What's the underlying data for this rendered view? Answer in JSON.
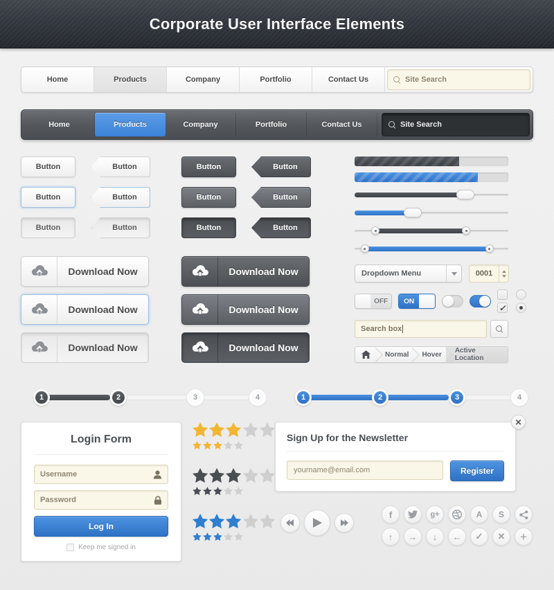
{
  "header": {
    "title": "Corporate User Interface Elements"
  },
  "nav_light": {
    "items": [
      {
        "label": "Home",
        "state": "normal"
      },
      {
        "label": "Products",
        "state": "active"
      },
      {
        "label": "Company",
        "state": "normal"
      },
      {
        "label": "Portfolio",
        "state": "normal"
      },
      {
        "label": "Contact Us",
        "state": "normal"
      }
    ],
    "search_placeholder": "Site Search"
  },
  "nav_dark": {
    "items": [
      {
        "label": "Home",
        "state": "normal"
      },
      {
        "label": "Products",
        "state": "active"
      },
      {
        "label": "Company",
        "state": "normal"
      },
      {
        "label": "Portfolio",
        "state": "normal"
      },
      {
        "label": "Contact Us",
        "state": "normal"
      }
    ],
    "search_placeholder": "Site Search"
  },
  "buttons": {
    "label": "Button",
    "light_states": [
      "normal",
      "hover",
      "pressed"
    ],
    "dark_states": [
      "normal",
      "hover",
      "pressed"
    ]
  },
  "download": {
    "label": "Download Now",
    "icon": "cloud-download-icon",
    "light_states": [
      "normal",
      "hover",
      "pressed"
    ],
    "dark_states": [
      "normal",
      "hover",
      "pressed"
    ]
  },
  "progress": [
    {
      "name": "progress-dark",
      "value": 68,
      "color": "#4a4e53"
    },
    {
      "name": "progress-blue",
      "value": 80,
      "color": "#2f72c6"
    }
  ],
  "sliders": [
    {
      "name": "slider-dark",
      "value": 84,
      "color": "#4a4e53"
    },
    {
      "name": "slider-blue",
      "value": 44,
      "color": "#2f72c6"
    }
  ],
  "range_sliders": [
    {
      "name": "range-dark",
      "start": 14,
      "end": 73,
      "color": "#4a4e53"
    },
    {
      "name": "range-blue",
      "start": 7,
      "end": 88,
      "color": "#2f72c6"
    }
  ],
  "dropdown": {
    "label": "Dropdown Menu",
    "icon": "chevron-down-icon"
  },
  "stepper": {
    "value": "0001"
  },
  "toggles": {
    "off_label": "OFF",
    "on_label": "ON"
  },
  "search_box": {
    "value": "Search box",
    "icon": "search-icon"
  },
  "breadcrumb": {
    "home_icon": "home-icon",
    "items": [
      {
        "label": "Normal",
        "state": "normal"
      },
      {
        "label": "Hover",
        "state": "hover"
      },
      {
        "label": "Active Location",
        "state": "active"
      }
    ]
  },
  "steps_dark": {
    "nodes": [
      "1",
      "2",
      "3",
      "4"
    ],
    "completed": 2,
    "color": "#4a4e53"
  },
  "steps_blue": {
    "nodes": [
      "1",
      "2",
      "3",
      "4"
    ],
    "completed": 3,
    "color": "#2f72c6"
  },
  "login": {
    "title": "Login Form",
    "username_placeholder": "Username",
    "username_icon": "user-icon",
    "password_placeholder": "Password",
    "password_icon": "lock-icon",
    "submit_label": "Log In",
    "remember_label": "Keep me signed in"
  },
  "ratings": [
    {
      "name": "rating-gold",
      "filled": 3,
      "total": 5,
      "color": "#f2b632",
      "empty_color": "#cfcfcf"
    },
    {
      "name": "rating-dark",
      "filled": 3,
      "total": 5,
      "color": "#4a4e53",
      "empty_color": "#cfcfcf"
    },
    {
      "name": "rating-blue",
      "filled": 3,
      "total": 5,
      "color": "#2f7ed0",
      "empty_color": "#cfcfcf"
    }
  ],
  "newsletter": {
    "title": "Sign Up for the Newsletter",
    "email_placeholder": "yourname@email.com",
    "button_label": "Register",
    "close_icon": "close-icon"
  },
  "media_controls": [
    {
      "name": "rewind-button",
      "icon": "rewind-icon"
    },
    {
      "name": "play-button",
      "icon": "play-icon"
    },
    {
      "name": "forward-button",
      "icon": "fast-forward-icon"
    }
  ],
  "social_icons": [
    {
      "name": "facebook-icon",
      "glyph": "f"
    },
    {
      "name": "twitter-icon",
      "glyph": "t"
    },
    {
      "name": "google-plus-icon",
      "glyph": "g+"
    },
    {
      "name": "dribbble-icon",
      "glyph": "d"
    },
    {
      "name": "forrst-icon",
      "glyph": "A"
    },
    {
      "name": "skype-icon",
      "glyph": "S"
    },
    {
      "name": "share-icon",
      "glyph": "<"
    }
  ],
  "action_icons": [
    {
      "name": "arrow-up-icon",
      "glyph": "↑"
    },
    {
      "name": "arrow-right-icon",
      "glyph": "→"
    },
    {
      "name": "arrow-down-icon",
      "glyph": "↓"
    },
    {
      "name": "arrow-left-icon",
      "glyph": "←"
    },
    {
      "name": "check-icon",
      "glyph": "✓"
    },
    {
      "name": "close-x-icon",
      "glyph": "✕"
    },
    {
      "name": "plus-icon",
      "glyph": "＋"
    }
  ],
  "colors": {
    "accent_blue": "#2f72c6",
    "dark_gray": "#4a4e53",
    "cream_field": "#faf6e8",
    "gold_star": "#f2b632"
  }
}
